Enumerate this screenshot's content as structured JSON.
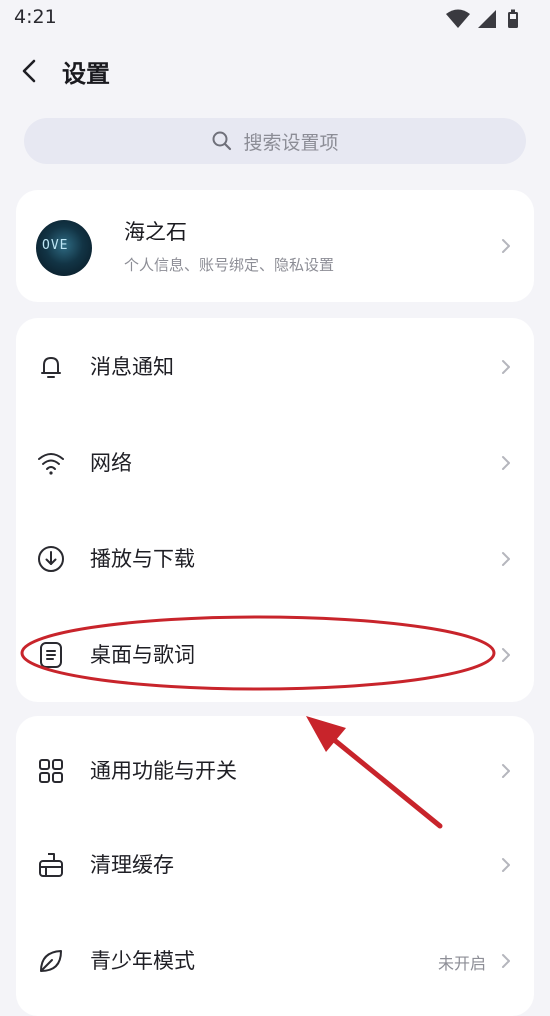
{
  "status_bar": {
    "time": "4:21"
  },
  "header": {
    "title": "设置"
  },
  "search": {
    "placeholder": "搜索设置项"
  },
  "profile": {
    "name": "海之石",
    "subtitle": "个人信息、账号绑定、隐私设置",
    "avatar_text": "OVE"
  },
  "group1": [
    {
      "label": "消息通知",
      "icon": "bell-icon"
    },
    {
      "label": "网络",
      "icon": "wifi-icon"
    },
    {
      "label": "播放与下载",
      "icon": "download-icon"
    },
    {
      "label": "桌面与歌词",
      "icon": "lyrics-document-icon"
    }
  ],
  "group2": [
    {
      "label": "通用功能与开关",
      "icon": "grid-icon"
    },
    {
      "label": "清理缓存",
      "icon": "broom-icon"
    },
    {
      "label": "青少年模式",
      "icon": "leaf-icon",
      "value": "未开启"
    }
  ],
  "colors": {
    "background": "#f4f4f8",
    "card": "#ffffff",
    "search_bg": "#e7e8f2",
    "annotation_red": "#c8242b"
  }
}
